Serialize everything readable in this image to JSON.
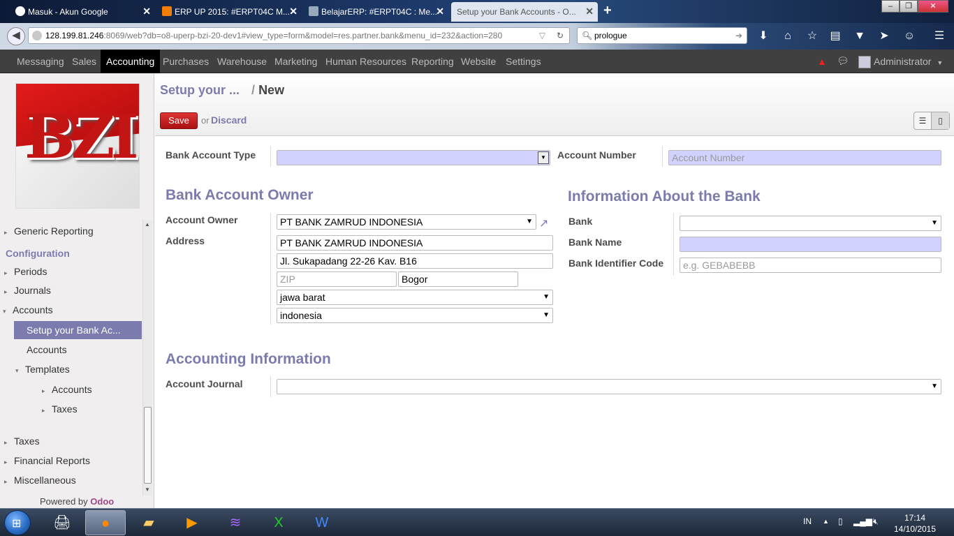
{
  "browser": {
    "tabs": [
      {
        "title": "Masuk - Akun Google",
        "active": false
      },
      {
        "title": "ERP UP 2015: #ERPT04C M...",
        "active": false
      },
      {
        "title": "BelajarERP: #ERPT04C : Me...",
        "active": false
      },
      {
        "title": "Setup your Bank Accounts - O...",
        "active": true
      }
    ],
    "new_tab": "+",
    "url_host": "128.199.81.246",
    "url_rest": ":8069/web?db=o8-uperp-bzi-20-dev1#view_type=form&model=res.partner.bank&menu_id=232&action=280",
    "search_value": "prologue"
  },
  "topmenu": {
    "items": [
      "Messaging",
      "Sales",
      "Accounting",
      "Purchases",
      "Warehouse",
      "Marketing",
      "Human Resources",
      "Reporting",
      "Website",
      "Settings"
    ],
    "active": "Accounting",
    "user": "Administrator"
  },
  "sidebar": {
    "logo_text": "BZI",
    "generic_reporting": "Generic Reporting",
    "configuration": "Configuration",
    "periods": "Periods",
    "journals": "Journals",
    "accounts": "Accounts",
    "setup_bank": "Setup your Bank Ac...",
    "accounts_sub": "Accounts",
    "templates": "Templates",
    "templates_accounts": "Accounts",
    "templates_taxes": "Taxes",
    "taxes": "Taxes",
    "financial_reports": "Financial Reports",
    "miscellaneous": "Miscellaneous",
    "powered_by": "Powered by",
    "odoo": "Odoo"
  },
  "control_panel": {
    "breadcrumb_parent": "Setup your ...",
    "breadcrumb_sep": "/",
    "breadcrumb_current": "New",
    "save": "Save",
    "or": "or",
    "discard": "Discard"
  },
  "form": {
    "bank_account_type_label": "Bank Account Type",
    "bank_account_type_value": "",
    "account_number_label": "Account Number",
    "account_number_placeholder": "Account Number",
    "owner_section": "Bank Account Owner",
    "account_owner_label": "Account Owner",
    "account_owner_value": "PT BANK ZAMRUD INDONESIA",
    "address_label": "Address",
    "address_name": "PT BANK ZAMRUD INDONESIA",
    "address_street": "Jl. Sukapadang 22-26 Kav. B16",
    "zip_placeholder": "ZIP",
    "city": "Bogor",
    "state": "jawa barat",
    "country": "indonesia",
    "bank_section": "Information About the Bank",
    "bank_label": "Bank",
    "bank_value": "",
    "bank_name_label": "Bank Name",
    "bank_name_value": "",
    "bic_label": "Bank Identifier Code",
    "bic_placeholder": "e.g. GEBABEBB",
    "accounting_section": "Accounting Information",
    "account_journal_label": "Account Journal",
    "account_journal_value": ""
  },
  "taskbar": {
    "lang": "IN",
    "time": "17:14",
    "date": "14/10/2015"
  },
  "colors": {
    "accent": "#7c7bad",
    "save_button": "#c21f1f",
    "topmenu_bg": "#404040",
    "required_field": "#d2d2ff"
  }
}
